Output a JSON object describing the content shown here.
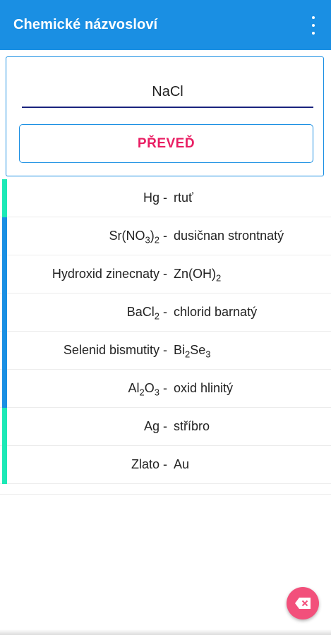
{
  "appbar": {
    "title": "Chemické názvosloví",
    "menu_icon": "overflow-menu-icon",
    "color": "#1a8fe3"
  },
  "converter": {
    "input_value": "NaCl",
    "button_label": "PŘEVEĎ",
    "button_color": "#e91e63"
  },
  "history": [
    {
      "left": "Hg",
      "right": "rtuť",
      "bar_color": "#1de9b6"
    },
    {
      "left": "Sr(NO3)2",
      "right": "dusičnan strontnatý",
      "bar_color": "#1a8fe3"
    },
    {
      "left": "Hydroxid zinecnaty",
      "right": "Zn(OH)2",
      "bar_color": "#1a8fe3"
    },
    {
      "left": "BaCl2",
      "right": "chlorid barnatý",
      "bar_color": "#1a8fe3"
    },
    {
      "left": "Selenid bismutity",
      "right": "Bi2Se3",
      "bar_color": "#1a8fe3"
    },
    {
      "left": "Al2O3",
      "right": "oxid hlinitý",
      "bar_color": "#1a8fe3"
    },
    {
      "left": "Ag",
      "right": "stříbro",
      "bar_color": "#1de9b6"
    },
    {
      "left": "Zlato",
      "right": "Au",
      "bar_color": "#1de9b6"
    }
  ],
  "separator": "-",
  "fab": {
    "icon": "backspace-icon",
    "color": "#f2507b"
  }
}
